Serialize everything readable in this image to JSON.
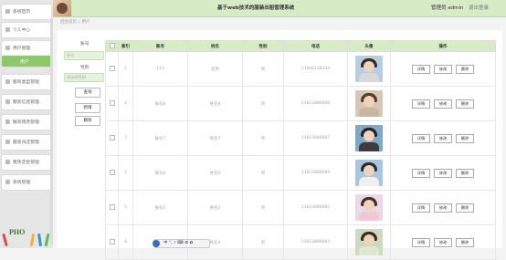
{
  "header": {
    "title": "基于web技术的服装出租管理系统",
    "user_label": "管理员 admin",
    "logout_label": "退出登录"
  },
  "sidebar": {
    "items": [
      {
        "label": "系统首页",
        "icon": "home-icon"
      },
      {
        "label": "个人中心",
        "icon": "person-icon"
      },
      {
        "label": "用户管理",
        "icon": "users-icon"
      },
      {
        "label": "用户",
        "icon": "list-icon",
        "active": true
      },
      {
        "label": "服装类型管理",
        "icon": "tag-icon"
      },
      {
        "label": "服装信息管理",
        "icon": "shirt-icon"
      },
      {
        "label": "服装租赁管理",
        "icon": "cart-icon"
      },
      {
        "label": "服装归还管理",
        "icon": "return-icon"
      },
      {
        "label": "租赁定金管理",
        "icon": "money-icon"
      },
      {
        "label": "系统管理",
        "icon": "gear-icon"
      }
    ],
    "bottom_art": "PHO"
  },
  "breadcrumb": {
    "home": "后台首页",
    "separator": "/",
    "current": "用户"
  },
  "filters": {
    "account_label": "账号",
    "account_placeholder": "账号",
    "gender_label": "性别",
    "gender_placeholder": "请选择性别",
    "search_label": "查询",
    "add_label": "新增",
    "delete_label": "删除"
  },
  "table": {
    "columns": [
      "",
      "索引",
      "账号",
      "姓名",
      "性别",
      "电话",
      "头像",
      "操作"
    ],
    "rows": [
      {
        "index": "1",
        "account": "111",
        "name": "名称",
        "gender": "男",
        "phone": "13800138344",
        "avatar_color": "#b8cfe3"
      },
      {
        "index": "2",
        "account": "账号8",
        "name": "姓名8",
        "gender": "男",
        "phone": "13823888888",
        "avatar_color": "#d6c7b8"
      },
      {
        "index": "3",
        "account": "账号7",
        "name": "姓名7",
        "gender": "男",
        "phone": "13823888887",
        "avatar_color": "#7fa7c9"
      },
      {
        "index": "4",
        "account": "账号6",
        "name": "姓名6",
        "gender": "男",
        "phone": "13823888886",
        "avatar_color": "#a9c6e0"
      },
      {
        "index": "5",
        "account": "账号5",
        "name": "姓名5",
        "gender": "男",
        "phone": "13823888885",
        "avatar_color": "#ead9e6"
      },
      {
        "index": "6",
        "account": "账号4",
        "name": "姓名4",
        "gender": "男",
        "phone": "13823888884",
        "avatar_color": "#cfd9c2"
      }
    ],
    "actions": {
      "detail": "详情",
      "edit": "修改",
      "delete": "删除"
    }
  },
  "page_toolbar": "中 °, ♪ ⌨ ⊞ ✿"
}
